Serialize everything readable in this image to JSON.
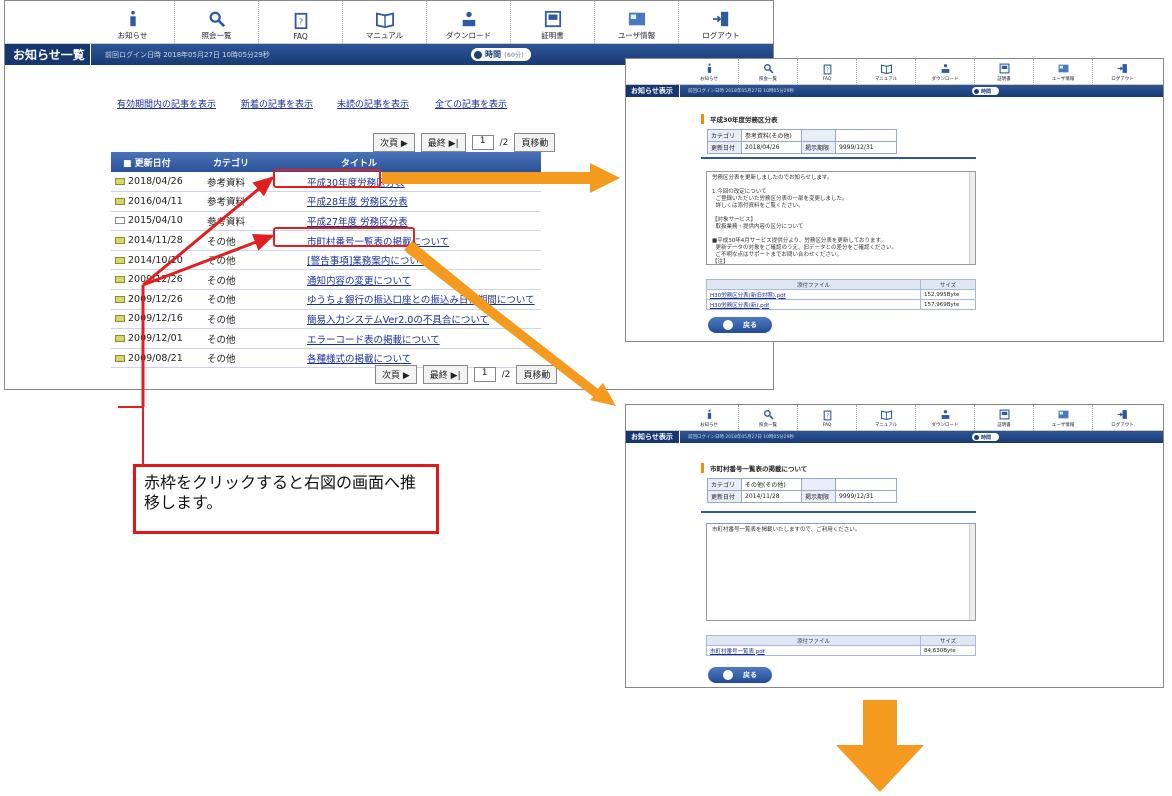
{
  "toolbar": {
    "items": [
      {
        "label": "お知らせ",
        "icon": "info-icon"
      },
      {
        "label": "照会一覧",
        "icon": "search-icon"
      },
      {
        "label": "FAQ",
        "icon": "faq-icon"
      },
      {
        "label": "マニュアル",
        "icon": "manual-icon"
      },
      {
        "label": "ダウンロード",
        "icon": "download-icon"
      },
      {
        "label": "証明書",
        "icon": "certificate-icon"
      },
      {
        "label": "ユーザ情報",
        "icon": "user-info-icon"
      },
      {
        "label": "ログアウト",
        "icon": "logout-icon"
      }
    ]
  },
  "main": {
    "title": "お知らせ一覧",
    "login_text": "前回ログイン日時 2018年05月27日 10時05分29秒",
    "timer_label": "時間",
    "timer_sub": "(60分)",
    "filters": [
      "有効期間内の記事を表示",
      "新着の記事を表示",
      "未読の記事を表示",
      "全ての記事を表示"
    ],
    "pager": {
      "next": "次頁 ▶",
      "last": "最終 ▶|",
      "page": "1",
      "total": "/2",
      "go": "頁移動"
    },
    "columns": [
      "更新日付",
      "カテゴリ",
      "タイトル"
    ],
    "rows": [
      {
        "date": "2018/04/26",
        "category": "参考資料",
        "title": "平成30年度労務区分表",
        "unread": true
      },
      {
        "date": "2016/04/11",
        "category": "参考資料",
        "title": "平成28年度 労務区分表",
        "unread": true
      },
      {
        "date": "2015/04/10",
        "category": "参考資料",
        "title": "平成27年度 労務区分表",
        "unread": false
      },
      {
        "date": "2014/11/28",
        "category": "その他",
        "title": "市町村番号一覧表の掲載について",
        "unread": true
      },
      {
        "date": "2014/10/10",
        "category": "その他",
        "title": "[警告事項]業務案内について",
        "unread": true
      },
      {
        "date": "2009/12/26",
        "category": "その他",
        "title": "通知内容の変更について",
        "unread": true
      },
      {
        "date": "2009/12/26",
        "category": "その他",
        "title": "ゆうちょ銀行の振込口座との振込み日付期間について",
        "unread": true
      },
      {
        "date": "2009/12/16",
        "category": "その他",
        "title": "簡易入力システムVer2.0の不具合について",
        "unread": true
      },
      {
        "date": "2009/12/01",
        "category": "その他",
        "title": "エラーコード表の掲載について",
        "unread": true
      },
      {
        "date": "2009/08/21",
        "category": "その他",
        "title": "各種様式の掲載について",
        "unread": true
      }
    ]
  },
  "callout": {
    "text": "赤枠をクリックすると右図の画面へ推移します。"
  },
  "detail1": {
    "title_bar": "お知らせ表示",
    "login_text": "前回ログイン日時 2018年05月27日 10時05分29秒",
    "timer_label": "時間",
    "heading": "平成30年度労務区分表",
    "info": [
      {
        "label": "カテゴリ",
        "value": "参考資料(その他)",
        "label2": "",
        "value2": ""
      },
      {
        "label": "更新日付",
        "value": "2018/04/26",
        "label2": "掲示期限",
        "value2": "9999/12/31"
      }
    ],
    "body_lines": [
      "労務区分表を更新しましたのでお知らせします。",
      "",
      "1.今回の改定について",
      "  ご登録いただいた労務区分表の一部を変更しました。",
      "  詳しくは添付資料をご覧ください。",
      "",
      "【対象サービス】",
      "  取扱業務・提供内容の区分について",
      "",
      "■平成30年4月サービス提供分より、労務区分表を更新しております。",
      "  更新データの対象をご確認のうえ、旧データとの差分をご確認ください。",
      "  ご不明な点はサポートまでお問い合わせください。",
      "【注】",
      "  1.労務区分表(旧)：労務区分表(新)と差し替えてご利用ください。",
      "  2.変更区分一覧：変更のあった区分のみ掲載しています。"
    ],
    "attach_header": [
      "添付ファイル",
      "サイズ"
    ],
    "attachments": [
      {
        "name": "H30労務区分表(新旧対照).pdf",
        "size": "152,995Byte"
      },
      {
        "name": "H30労務区分表(新).pdf",
        "size": "157,969Byte"
      }
    ],
    "back_label": "戻る"
  },
  "detail2": {
    "title_bar": "お知らせ表示",
    "login_text": "前回ログイン日時 2018年05月27日 10時05分29秒",
    "timer_label": "時間",
    "heading": "市町村番号一覧表の掲載について",
    "info": [
      {
        "label": "カテゴリ",
        "value": "その他(その他)",
        "label2": "",
        "value2": ""
      },
      {
        "label": "更新日付",
        "value": "2014/11/28",
        "label2": "掲示期限",
        "value2": "9999/12/31"
      }
    ],
    "body_lines": [
      "市町村番号一覧表を掲載いたしますので、ご利用ください。"
    ],
    "attach_header": [
      "添付ファイル",
      "サイズ"
    ],
    "attachments": [
      {
        "name": "市町村番号一覧表.pdf",
        "size": "84,630Byte"
      }
    ],
    "back_label": "戻る"
  },
  "colors": {
    "accent": "#e02020",
    "arrow": "#f39a1f",
    "bar": "#1f4582"
  }
}
